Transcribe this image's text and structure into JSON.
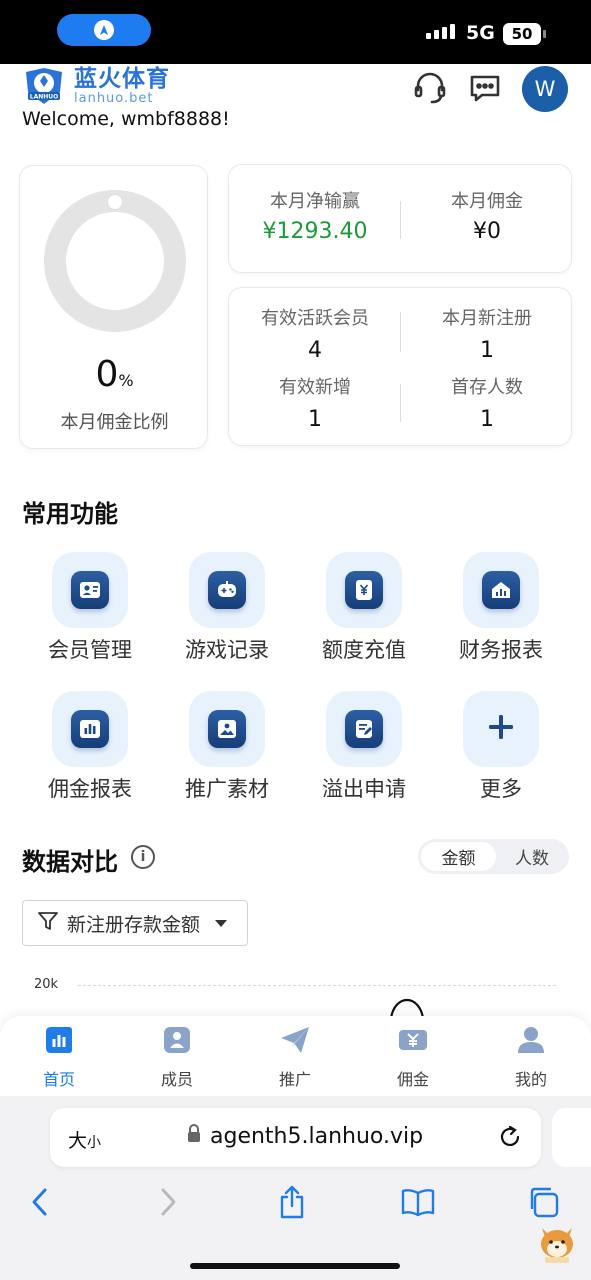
{
  "status_bar": {
    "network": "5G",
    "battery": "50"
  },
  "brand": {
    "name": "蓝火体育",
    "domain": "lanhuo.bet",
    "badge_text": "LANHUO"
  },
  "header": {
    "welcome": "Welcome, wmbf8888!",
    "avatar_letter": "W"
  },
  "ratio_card": {
    "value": "0",
    "unit": "%",
    "label": "本月佣金比例"
  },
  "monthly": [
    {
      "label": "本月净输赢",
      "value": "¥1293.40"
    },
    {
      "label": "本月佣金",
      "value": "¥0"
    }
  ],
  "members": [
    {
      "label": "有效活跃会员",
      "value": "4"
    },
    {
      "label": "本月新注册",
      "value": "1"
    },
    {
      "label": "有效新增",
      "value": "1"
    },
    {
      "label": "首存人数",
      "value": "1"
    }
  ],
  "common_functions": {
    "title": "常用功能",
    "items": [
      {
        "label": "会员管理",
        "icon": "member-card-icon"
      },
      {
        "label": "游戏记录",
        "icon": "gamepad-icon"
      },
      {
        "label": "额度充值",
        "icon": "yuan-icon"
      },
      {
        "label": "财务报表",
        "icon": "finance-icon"
      },
      {
        "label": "佣金报表",
        "icon": "bar-chart-icon"
      },
      {
        "label": "推广素材",
        "icon": "image-icon"
      },
      {
        "label": "溢出申请",
        "icon": "edit-form-icon"
      },
      {
        "label": "更多",
        "icon": "plus-icon"
      }
    ]
  },
  "data_compare": {
    "title": "数据对比",
    "segments": [
      "金额",
      "人数"
    ],
    "selected_segment": "金额",
    "filter": "新注册存款金额",
    "y_tick": "20k"
  },
  "tabbar": [
    {
      "label": "首页",
      "active": true
    },
    {
      "label": "成员",
      "active": false
    },
    {
      "label": "推广",
      "active": false
    },
    {
      "label": "佣金",
      "active": false
    },
    {
      "label": "我的",
      "active": false
    }
  ],
  "browser": {
    "text_size": "大",
    "text_size_small": "小",
    "url": "agenth5.lanhuo.vip"
  },
  "colors": {
    "accent": "#1f7ce8",
    "positive": "#1e9a35",
    "brand": "#2a73d9",
    "icon_tile": "#1d4a8a"
  }
}
